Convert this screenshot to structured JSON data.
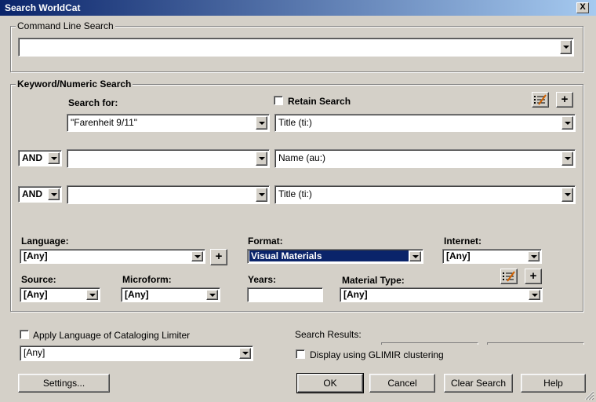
{
  "window": {
    "title": "Search WorldCat",
    "close_glyph": "X"
  },
  "command_line": {
    "legend": "Command Line Search",
    "value": ""
  },
  "keyword": {
    "legend": "Keyword/Numeric Search",
    "search_for_label": "Search for:",
    "retain_label": "Retain Search",
    "retain_checked": false,
    "rows": [
      {
        "operator": "",
        "term": "\"Farenheit 9/11\"",
        "index": "Title (ti:)"
      },
      {
        "operator": "AND",
        "term": "",
        "index": "Name (au:)"
      },
      {
        "operator": "AND",
        "term": "",
        "index": "Title (ti:)"
      }
    ],
    "add_glyph": "+"
  },
  "limits": {
    "language_label": "Language:",
    "language_value": "[Any]",
    "format_label": "Format:",
    "format_value": "Visual Materials",
    "internet_label": "Internet:",
    "internet_value": "[Any]",
    "source_label": "Source:",
    "source_value": "[Any]",
    "microform_label": "Microform:",
    "microform_value": "[Any]",
    "years_label": "Years:",
    "years_value": "",
    "material_type_label": "Material Type:",
    "material_type_value": "[Any]"
  },
  "bottom": {
    "apply_language_label": "Apply Language of Cataloging Limiter",
    "apply_language_checked": false,
    "apply_language_value": "[Any]",
    "search_results_label": "Search Results:",
    "glimir_label": "Display using GLIMIR clustering",
    "glimir_checked": false
  },
  "buttons": {
    "settings": "Settings...",
    "ok": "OK",
    "cancel": "Cancel",
    "clear": "Clear Search",
    "help": "Help"
  },
  "colors": {
    "titlebar": "#0a246a",
    "selection": "#0a246a",
    "dialog_bg": "#d4d0c8"
  }
}
